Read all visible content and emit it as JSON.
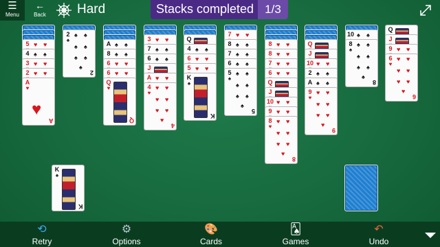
{
  "topbar": {
    "menu_label": "Menu",
    "back_label": "Back",
    "difficulty": "Hard",
    "stacks_label": "Stacks completed",
    "stacks_count": "1/3"
  },
  "toolbar": {
    "retry": "Retry",
    "options": "Options",
    "cards": "Cards",
    "games": "Games",
    "undo": "Undo"
  },
  "colors": {
    "felt": "#176a3e",
    "bar": "#0a3d20",
    "pill": "#4b2a86",
    "card_back": "#1f7fd0",
    "red_suit": "#d6181f"
  },
  "tableau": [
    {
      "column": 1,
      "hidden": 3,
      "up": [
        {
          "r": "5",
          "s": "♥"
        },
        {
          "r": "4",
          "s": "♠"
        },
        {
          "r": "3",
          "s": "♥"
        },
        {
          "r": "2",
          "s": "♥"
        },
        {
          "r": "A",
          "s": "♥"
        }
      ]
    },
    {
      "column": 2,
      "hidden": 1,
      "up": [
        {
          "r": "2",
          "s": "♠"
        }
      ]
    },
    {
      "column": 3,
      "hidden": 3,
      "up": [
        {
          "r": "A",
          "s": "♠"
        },
        {
          "r": "8",
          "s": "♠"
        },
        {
          "r": "6",
          "s": "♥"
        },
        {
          "r": "6",
          "s": "♥"
        },
        {
          "r": "Q",
          "s": "♥"
        }
      ]
    },
    {
      "column": 4,
      "hidden": 2,
      "up": [
        {
          "r": "3",
          "s": "♥"
        },
        {
          "r": "7",
          "s": "♠"
        },
        {
          "r": "6",
          "s": "♠"
        },
        {
          "r": "J",
          "s": "♥"
        },
        {
          "r": "A",
          "s": "♥"
        },
        {
          "r": "4",
          "s": "♥"
        }
      ]
    },
    {
      "column": 5,
      "hidden": 2,
      "up": [
        {
          "r": "Q",
          "s": "♠"
        },
        {
          "r": "4",
          "s": "♠"
        },
        {
          "r": "6",
          "s": "♥"
        },
        {
          "r": "5",
          "s": "♥"
        },
        {
          "r": "K",
          "s": "♠"
        }
      ]
    },
    {
      "column": 6,
      "hidden": 1,
      "up": [
        {
          "r": "7",
          "s": "♥"
        },
        {
          "r": "8",
          "s": "♠"
        },
        {
          "r": "7",
          "s": "♠"
        },
        {
          "r": "6",
          "s": "♠"
        },
        {
          "r": "5",
          "s": "♠"
        }
      ]
    },
    {
      "column": 7,
      "hidden": 3,
      "up": [
        {
          "r": "8",
          "s": "♥"
        },
        {
          "r": "8",
          "s": "♥"
        },
        {
          "r": "7",
          "s": "♥"
        },
        {
          "r": "6",
          "s": "♥"
        },
        {
          "r": "Q",
          "s": "♥"
        },
        {
          "r": "J",
          "s": "♥"
        },
        {
          "r": "10",
          "s": "♥"
        },
        {
          "r": "9",
          "s": "♥"
        },
        {
          "r": "8",
          "s": "♥"
        }
      ]
    },
    {
      "column": 8,
      "hidden": 3,
      "up": [
        {
          "r": "Q",
          "s": "♥"
        },
        {
          "r": "J",
          "s": "♥"
        },
        {
          "r": "10",
          "s": "♥"
        },
        {
          "r": "2",
          "s": "♠"
        },
        {
          "r": "A",
          "s": "♠"
        },
        {
          "r": "9",
          "s": "♥"
        }
      ]
    },
    {
      "column": 9,
      "hidden": 1,
      "up": [
        {
          "r": "10",
          "s": "♠"
        },
        {
          "r": "8",
          "s": "♠"
        }
      ]
    },
    {
      "column": 10,
      "hidden": 0,
      "up": [
        {
          "r": "Q",
          "s": "♠"
        },
        {
          "r": "J",
          "s": "♥"
        },
        {
          "r": "9",
          "s": "♥"
        },
        {
          "r": "6",
          "s": "♥"
        }
      ]
    }
  ],
  "completed_king": {
    "r": "K",
    "s": "♠"
  },
  "stock_piles": 1
}
